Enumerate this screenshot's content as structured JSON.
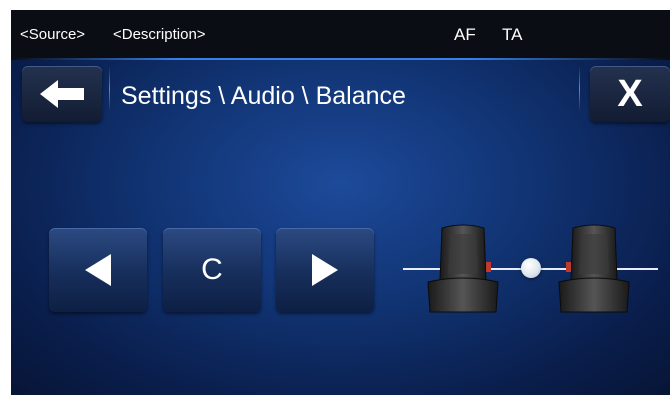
{
  "status_bar": {
    "source": "<Source>",
    "description": "<Description>",
    "af": "AF",
    "ta": "TA"
  },
  "header": {
    "back_icon": "arrow-left-icon",
    "title": "Settings \\ Audio \\ Balance",
    "close_label": "X"
  },
  "balance": {
    "left_icon": "triangle-left-icon",
    "center_label": "C",
    "right_icon": "triangle-right-icon",
    "position": 0.5,
    "seats": [
      "seat-left-icon",
      "seat-right-icon"
    ]
  },
  "colors": {
    "background": "#113474",
    "status_bar": "#0a0d14",
    "accent": "#3c8cff",
    "seat_marker": "#c0392b"
  }
}
